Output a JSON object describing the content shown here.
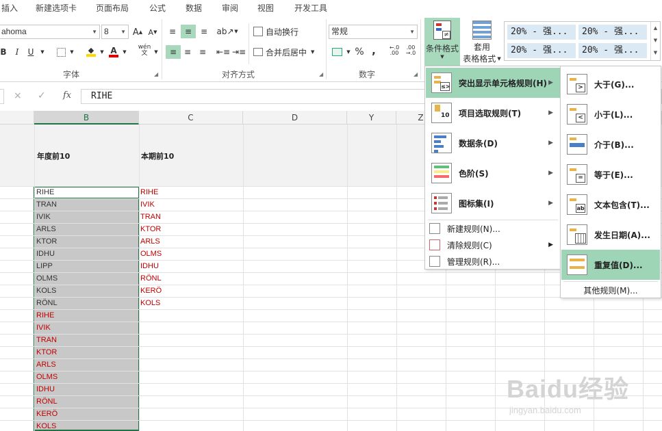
{
  "tabs": [
    "插入",
    "新建选项卡",
    "页面布局",
    "公式",
    "数据",
    "审阅",
    "视图",
    "开发工具"
  ],
  "font": {
    "name": "ahoma",
    "size": "8",
    "group_label": "字体",
    "grow_label": "A",
    "shrink_label": "A",
    "bold": "B",
    "italic": "I",
    "underline": "U",
    "wen_label": "wén"
  },
  "alignment": {
    "wrap_label": "自动换行",
    "merge_label": "合并后居中",
    "group_label": "对齐方式"
  },
  "number": {
    "format": "常规",
    "percent": "%",
    "comma": ",",
    "group_label": "数字"
  },
  "styles": {
    "conditional_format": "条件格式",
    "table_format_line1": "套用",
    "table_format_line2": "表格格式",
    "cells": [
      "20% - 强...",
      "20% - 强...",
      "20% - 强...",
      "20% - 强..."
    ]
  },
  "formula_bar": {
    "cancel": "×",
    "enter": "✓",
    "fx": "fx",
    "value": "RIHE"
  },
  "columns": [
    "B",
    "C",
    "D",
    "Y",
    "Z"
  ],
  "headers": {
    "b": "年度前10",
    "c": "本期前10"
  },
  "col_b": [
    "RIHE",
    "TRAN",
    "IVIK",
    "ARLS",
    "KTOR",
    "IDHU",
    "LIPP",
    "OLMS",
    "KOLS",
    "RÖNL",
    "RIHE",
    "IVIK",
    "TRAN",
    "KTOR",
    "ARLS",
    "OLMS",
    "IDHU",
    "RÖNL",
    "KERÖ",
    "KOLS"
  ],
  "col_c": [
    "RIHE",
    "IVIK",
    "TRAN",
    "KTOR",
    "ARLS",
    "OLMS",
    "IDHU",
    "RÖNL",
    "KERÖ",
    "KOLS"
  ],
  "menu1": {
    "items": [
      {
        "label": "突出显示单元格规则(H)",
        "icon": "highlight-rules-icon"
      },
      {
        "label": "项目选取规则(T)",
        "icon": "top-bottom-rules-icon"
      },
      {
        "label": "数据条(D)",
        "icon": "data-bars-icon"
      },
      {
        "label": "色阶(S)",
        "icon": "color-scales-icon"
      },
      {
        "label": "图标集(I)",
        "icon": "icon-sets-icon"
      }
    ],
    "small": [
      {
        "label": "新建规则(N)...",
        "icon": "new-rule-icon"
      },
      {
        "label": "清除规则(C)",
        "icon": "clear-rules-icon"
      },
      {
        "label": "管理规则(R)...",
        "icon": "manage-rules-icon"
      }
    ]
  },
  "menu2": {
    "items": [
      {
        "label": "大于(G)...",
        "icon": "greater-than-icon"
      },
      {
        "label": "小于(L)...",
        "icon": "less-than-icon"
      },
      {
        "label": "介于(B)...",
        "icon": "between-icon"
      },
      {
        "label": "等于(E)...",
        "icon": "equal-to-icon"
      },
      {
        "label": "文本包含(T)...",
        "icon": "text-contains-icon"
      },
      {
        "label": "发生日期(A)...",
        "icon": "date-occurring-icon"
      },
      {
        "label": "重复值(D)...",
        "icon": "duplicate-values-icon"
      }
    ],
    "more": "其他规则(M)..."
  },
  "watermark": {
    "brand": "Baidu经验",
    "url": "jingyan.baidu.com"
  },
  "colors": {
    "accent_green": "#217346",
    "highlight": "#9fd5b7",
    "red_text": "#c00000",
    "selection_gray": "#c8c8c8"
  }
}
